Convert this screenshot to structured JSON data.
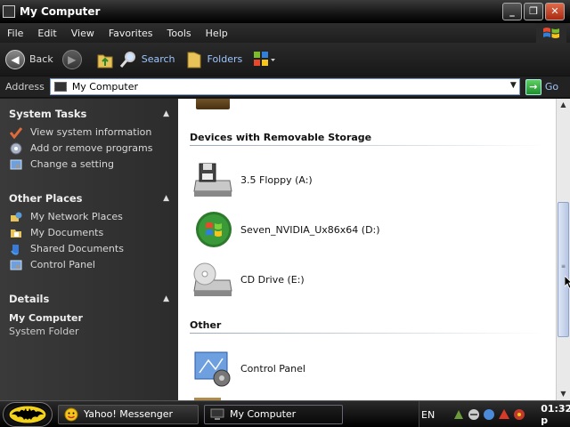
{
  "window": {
    "title": "My Computer"
  },
  "menu": [
    "File",
    "Edit",
    "View",
    "Favorites",
    "Tools",
    "Help"
  ],
  "toolbar": {
    "back_label": "Back",
    "search_label": "Search",
    "folders_label": "Folders"
  },
  "address": {
    "label": "Address",
    "value": "My Computer",
    "go_label": "Go"
  },
  "task_pane": {
    "system_tasks": {
      "title": "System Tasks",
      "items": [
        "View system information",
        "Add or remove programs",
        "Change a setting"
      ]
    },
    "other_places": {
      "title": "Other Places",
      "items": [
        "My Network Places",
        "My Documents",
        "Shared Documents",
        "Control Panel"
      ]
    },
    "details": {
      "title": "Details",
      "name": "My Computer",
      "type": "System Folder"
    }
  },
  "content": {
    "groups": [
      {
        "title": "Devices with Removable Storage",
        "items": [
          {
            "label": "3.5 Floppy (A:)",
            "icon": "floppy-drive-icon"
          },
          {
            "label": "Seven_NVIDIA_Ux86x64 (D:)",
            "icon": "windows-dvd-icon"
          },
          {
            "label": "CD Drive (E:)",
            "icon": "cd-drive-icon"
          }
        ]
      },
      {
        "title": "Other",
        "items": [
          {
            "label": "Control Panel",
            "icon": "control-panel-icon"
          }
        ]
      }
    ]
  },
  "taskbar": {
    "buttons": [
      "Yahoo! Messenger",
      "My Computer"
    ],
    "language": "EN",
    "clock": "01:32 p"
  },
  "colors": {
    "link": "#9ec6ff",
    "window_frame": "#141414",
    "content_bg": "#ffffff"
  }
}
